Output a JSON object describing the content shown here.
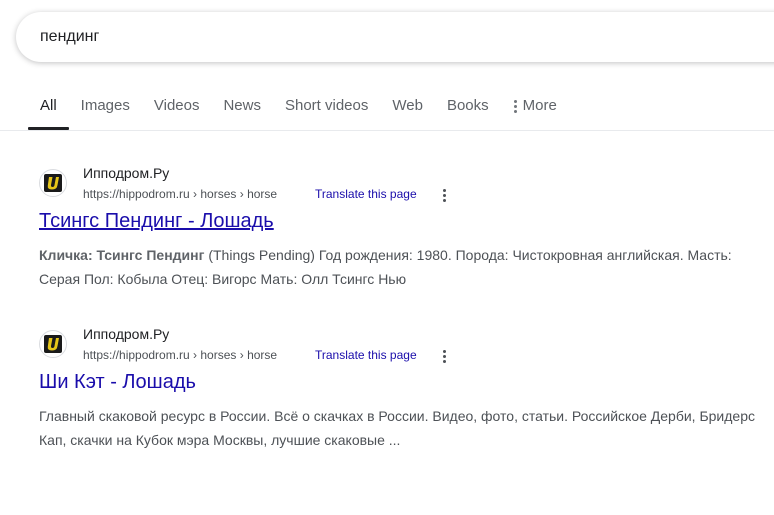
{
  "search": {
    "query": "пендинг"
  },
  "tabs": [
    {
      "label": "All",
      "active": true
    },
    {
      "label": "Images"
    },
    {
      "label": "Videos"
    },
    {
      "label": "News"
    },
    {
      "label": "Short videos"
    },
    {
      "label": "Web"
    },
    {
      "label": "Books"
    },
    {
      "label": "More",
      "icon": "vertical-dots-icon"
    }
  ],
  "results": [
    {
      "site_name": "Ипподром.Ру",
      "url": "https://hippodrom.ru › horses › horse",
      "translate": "Translate this page",
      "title": "Тсингс Пендинг - Лошадь",
      "snippet_bold": "Кличка: Тсингс Пендинг",
      "snippet_rest": " (Things Pending) Год рождения: 1980. Порода: Чистокровная английская. Масть: Серая Пол: Кобыла Отец: Вигорс Мать: Олл Тсингс Нью"
    },
    {
      "site_name": "Ипподром.Ру",
      "url": "https://hippodrom.ru › horses › horse",
      "translate": "Translate this page",
      "title": "Ши Кэт - Лошадь",
      "snippet": "Главный скаковой ресурс в России. Всё о скачках в России. Видео, фото, статьи. Российское Дерби, Бридерс Кап, скачки на Кубок мэра Москвы, лучшие скаковые ..."
    }
  ],
  "colors": {
    "link": "#1a0dab",
    "text": "#202124",
    "muted": "#4d5156",
    "favicon_bg": "#1a1a1a",
    "favicon_accent": "#e6c619"
  }
}
